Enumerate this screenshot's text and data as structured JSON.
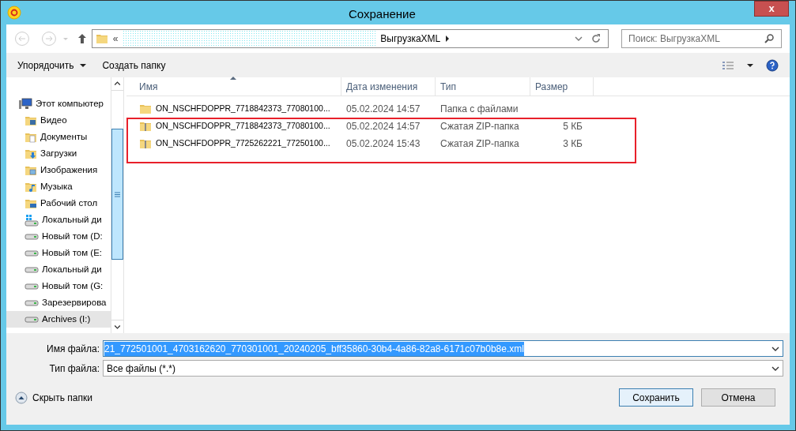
{
  "window": {
    "title": "Сохранение",
    "close": "x"
  },
  "nav": {
    "breadcrumb_prefix": "«",
    "breadcrumb": "ВыгрузкаXML",
    "search_placeholder": "Поиск: ВыгрузкаXML"
  },
  "toolbar": {
    "organize": "Упорядочить",
    "new_folder": "Создать папку"
  },
  "sidebar": {
    "items": [
      {
        "label": "Этот компьютер",
        "kind": "computer",
        "selected": false,
        "children": [
          {
            "label": "Видео",
            "kind": "video",
            "selected": false
          },
          {
            "label": "Документы",
            "kind": "docs",
            "selected": false
          },
          {
            "label": "Загрузки",
            "kind": "downloads",
            "selected": false
          },
          {
            "label": "Изображения",
            "kind": "images",
            "selected": false
          },
          {
            "label": "Музыка",
            "kind": "music",
            "selected": false
          },
          {
            "label": "Рабочий стол",
            "kind": "desktop",
            "selected": false
          },
          {
            "label": "Локальный ди",
            "kind": "sysdrive",
            "selected": false
          },
          {
            "label": "Новый том (D:",
            "kind": "drive",
            "selected": false
          },
          {
            "label": "Новый том (E:",
            "kind": "drive",
            "selected": false
          },
          {
            "label": "Локальный ди",
            "kind": "drive",
            "selected": false
          },
          {
            "label": "Новый том (G:",
            "kind": "drive",
            "selected": false
          },
          {
            "label": "Зарезервирова",
            "kind": "drive",
            "selected": false
          },
          {
            "label": "Archives (I:)",
            "kind": "drive",
            "selected": true
          }
        ]
      }
    ]
  },
  "table": {
    "columns": [
      "Имя",
      "Дата изменения",
      "Тип",
      "Размер"
    ],
    "rows": [
      {
        "kind": "folder",
        "name": "ON_NSCHFDOPPR_7718842373_77080100...",
        "date": "05.02.2024 14:57",
        "type": "Папка с файлами"
      },
      {
        "kind": "zip",
        "name": "ON_NSCHFDOPPR_7718842373_77080100...",
        "date": "05.02.2024 14:57",
        "type": "Сжатая ZIP-папка",
        "size": "5 КБ"
      },
      {
        "kind": "zip",
        "name": "ON_NSCHFDOPPR_7725262221_77250100...",
        "date": "05.02.2024 15:43",
        "type": "Сжатая ZIP-папка",
        "size": "3 КБ"
      }
    ]
  },
  "form": {
    "file_name_label": "Имя файла:",
    "file_name": "21_772501001_4703162620_770301001_20240205_bff35860-30b4-4a86-82a8-6171c07b0b8e.xml",
    "file_type_label": "Тип файла:",
    "file_type": "Все файлы (*.*)"
  },
  "footer": {
    "hide_folders": "Скрыть папки",
    "save": "Сохранить",
    "cancel": "Отмена"
  }
}
